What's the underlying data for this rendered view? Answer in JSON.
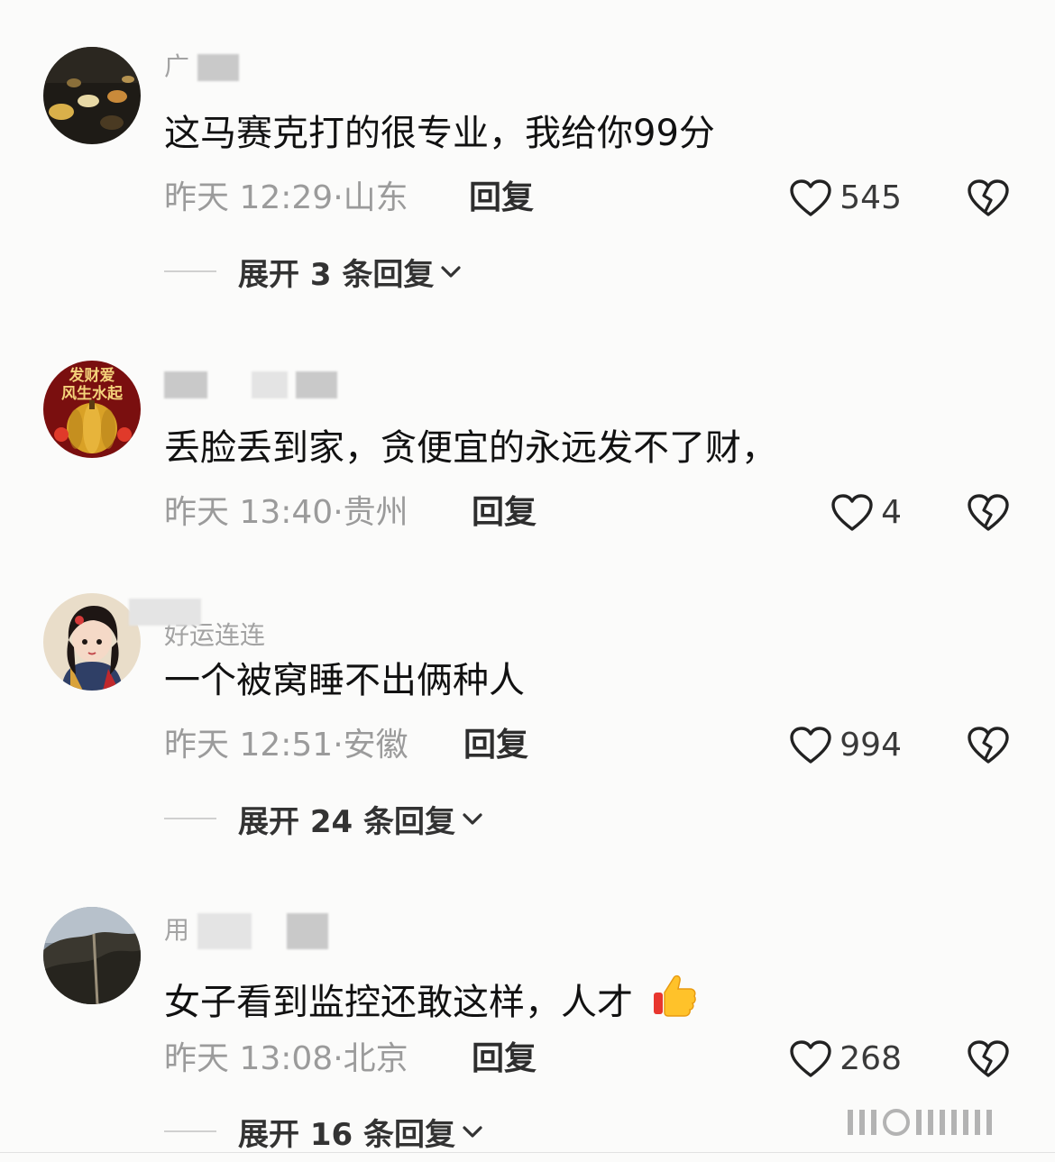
{
  "comments": [
    {
      "username": "广",
      "text": "这马赛克打的很专业，我给你99分",
      "time": "昨天 12:29",
      "location": "山东",
      "reply_label": "回复",
      "likes": "545",
      "expand_label": "展开 3 条回复"
    },
    {
      "username": "",
      "text": "丢脸丢到家，贪便宜的永远发不了财，",
      "time": "昨天 13:40",
      "location": "贵州",
      "reply_label": "回复",
      "likes": "4"
    },
    {
      "username": "好运连连",
      "text": "一个被窝睡不出俩种人",
      "time": "昨天 12:51",
      "location": "安徽",
      "reply_label": "回复",
      "likes": "994",
      "expand_label": "展开 24 条回复"
    },
    {
      "username": "用",
      "text": "女子看到监控还敢这样，人才",
      "time": "昨天 13:08",
      "location": "北京",
      "reply_label": "回复",
      "likes": "268",
      "expand_label": "展开 16 条回复"
    }
  ],
  "avatar2_text": "发财爱\n风生水起",
  "icons": {
    "like": "heart-outline-icon",
    "dislike": "broken-heart-icon",
    "expand": "chevron-down-icon",
    "emoji": "thumbs-up-emoji"
  },
  "colors": {
    "text": "#111111",
    "meta": "#9b9b9b",
    "username": "#a3a3a3"
  }
}
